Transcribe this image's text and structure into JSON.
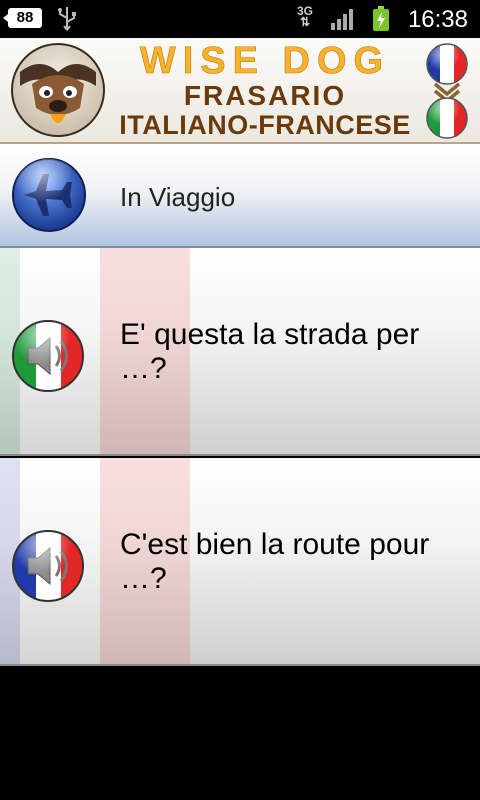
{
  "status_bar": {
    "notification_count": "88",
    "network_type": "3G",
    "time": "16:38"
  },
  "header": {
    "title_line1": "WISE DOG",
    "title_line2": "FRASARIO",
    "title_line3": "ITALIANO-FRANCESE",
    "source_flag": "france-flag-icon",
    "target_flag": "italy-flag-icon"
  },
  "category": {
    "icon": "airplane-icon",
    "label": "In Viaggio"
  },
  "phrases": [
    {
      "lang_icon": "italy-speaker-icon",
      "text": "E' questa la strada per …?"
    },
    {
      "lang_icon": "france-speaker-icon",
      "text": "C'est bien la route pour …?"
    }
  ],
  "colors": {
    "title_orange": "#f5b12f",
    "title_brown": "#6a3a0c",
    "category_blue": "#b2c5e0",
    "plane_blue": "#2a58b8"
  }
}
